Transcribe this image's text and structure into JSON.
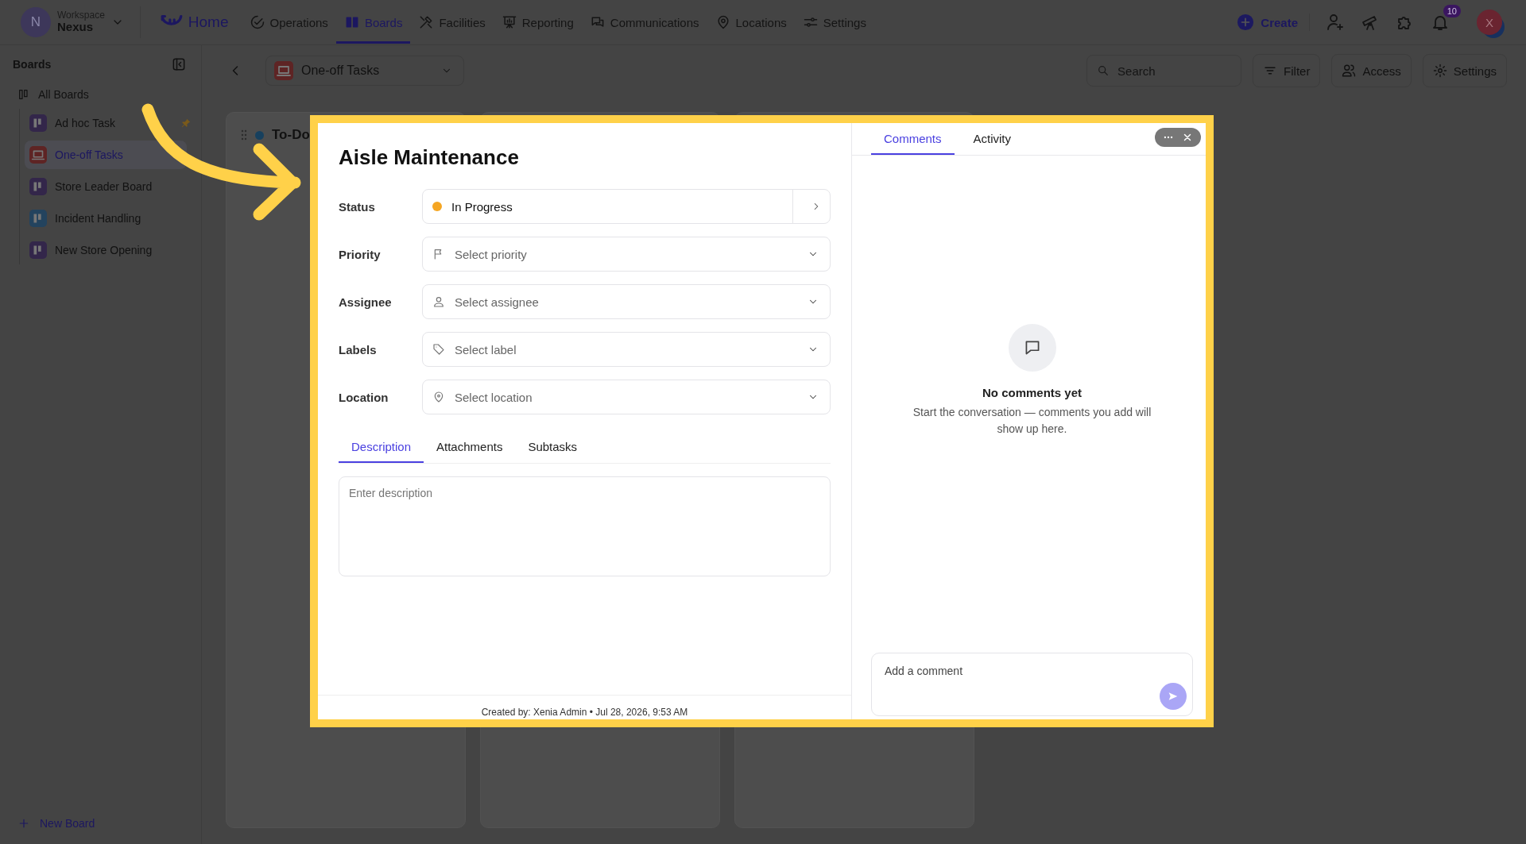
{
  "top_nav": {
    "workspace_label": "Workspace",
    "workspace_name": "Nexus",
    "workspace_avatar": "N",
    "home": "Home",
    "items": [
      {
        "label": "Operations",
        "selected": false
      },
      {
        "label": "Boards",
        "selected": true
      },
      {
        "label": "Facilities",
        "selected": false
      },
      {
        "label": "Reporting",
        "selected": false
      },
      {
        "label": "Communications",
        "selected": false
      },
      {
        "label": "Locations",
        "selected": false
      },
      {
        "label": "Settings",
        "selected": false
      }
    ],
    "create": "Create",
    "notification_count": "10",
    "user_avatar": "X"
  },
  "sidebar": {
    "title": "Boards",
    "all_boards": "All Boards",
    "boards": [
      {
        "name": "Ad hoc Task",
        "kind": "board",
        "color": "#33264a",
        "selected": false,
        "pinned": true
      },
      {
        "name": "One-off Tasks",
        "kind": "screen",
        "color": "#5e2424",
        "selected": true,
        "pinned": false
      },
      {
        "name": "Store Leader Board",
        "kind": "board",
        "color": "#33264a",
        "selected": false,
        "pinned": false
      },
      {
        "name": "Incident Handling",
        "kind": "board",
        "color": "#23435e",
        "selected": false,
        "pinned": false
      },
      {
        "name": "New Store Opening",
        "kind": "board",
        "color": "#33264a",
        "selected": false,
        "pinned": false
      }
    ],
    "new_board": "New Board"
  },
  "toolbar": {
    "board_name": "One-off Tasks",
    "search": {
      "placeholder": "Search"
    },
    "buttons": [
      "Filter",
      "Access",
      "Settings"
    ]
  },
  "board": {
    "column_title": "To-Do"
  },
  "task": {
    "title": "Aisle Maintenance",
    "fields": [
      {
        "label": "Status",
        "kind": "status",
        "value": "In Progress",
        "color": "#f5a623"
      },
      {
        "label": "Priority",
        "kind": "select",
        "placeholder": "Select priority"
      },
      {
        "label": "Assignee",
        "kind": "select",
        "placeholder": "Select assignee"
      },
      {
        "label": "Labels",
        "kind": "select",
        "placeholder": "Select label"
      },
      {
        "label": "Location",
        "kind": "select",
        "placeholder": "Select location"
      }
    ],
    "tabs": [
      {
        "label": "Description",
        "selected": true
      },
      {
        "label": "Attachments",
        "selected": false
      },
      {
        "label": "Subtasks",
        "selected": false
      }
    ],
    "description": {
      "placeholder": "Enter description"
    },
    "footer": "Created by: Xenia Admin • Jul 28, 2026, 9:53 AM",
    "side_tabs": [
      {
        "label": "Comments",
        "selected": true
      },
      {
        "label": "Activity",
        "selected": false
      }
    ],
    "empty_title": "No comments yet",
    "empty_text": "Start the conversation — comments you add will show up here.",
    "comment": {
      "placeholder": "Add a comment"
    }
  }
}
